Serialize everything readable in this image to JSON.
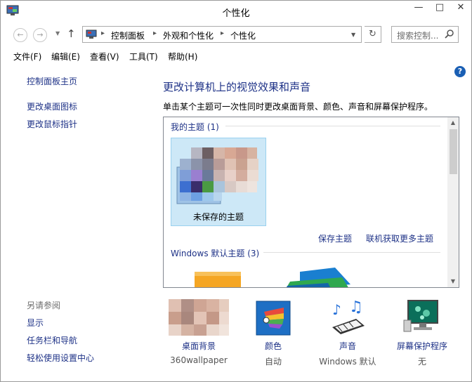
{
  "window": {
    "title": "个性化",
    "controls": [
      "—",
      "□",
      "✕"
    ]
  },
  "nav": {
    "back": "←",
    "forward": "→",
    "up": "↑",
    "breadcrumbs": [
      "控制面板",
      "外观和个性化",
      "个性化"
    ],
    "search_placeholder": "搜索控制..."
  },
  "menu": [
    "文件(F)",
    "编辑(E)",
    "查看(V)",
    "工具(T)",
    "帮助(H)"
  ],
  "left_pane": {
    "home": "控制面板主页",
    "links": [
      "更改桌面图标",
      "更改鼠标指针"
    ],
    "see_also_title": "另请参阅",
    "see_also": [
      "显示",
      "任务栏和导航",
      "轻松使用设置中心"
    ]
  },
  "main": {
    "help": "?",
    "heading": "更改计算机上的视觉效果和声音",
    "description": "单击某个主题可一次性同时更改桌面背景、颜色、声音和屏幕保护程序。",
    "my_themes_label": "我的主题 (1)",
    "unsaved_theme": "未保存的主题",
    "save_theme": "保存主题",
    "get_more_online": "联机获取更多主题",
    "windows_default_label": "Windows 默认主题 (3)"
  },
  "bottom": [
    {
      "label": "桌面背景",
      "sub": "360wallpaper",
      "icon": "desktop-background-icon"
    },
    {
      "label": "颜色",
      "sub": "自动",
      "icon": "color-palette-icon"
    },
    {
      "label": "声音",
      "sub": "Windows 默认",
      "icon": "sound-icon"
    },
    {
      "label": "屏幕保护程序",
      "sub": "无",
      "icon": "screensaver-icon"
    }
  ],
  "colors": {
    "link": "#1e3287",
    "selection": "#cde8f7",
    "selection_border": "#99d1ef"
  }
}
